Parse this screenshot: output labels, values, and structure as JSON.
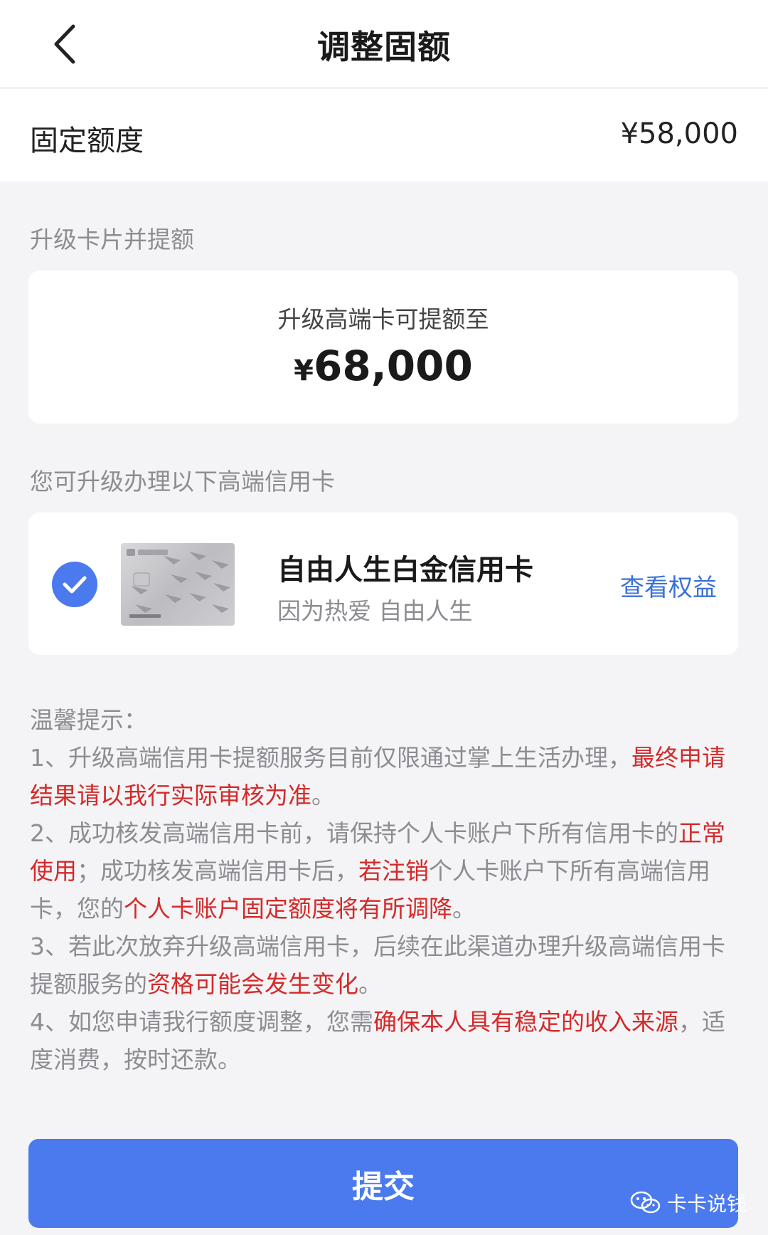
{
  "header": {
    "title": "调整固额"
  },
  "fixed_limit": {
    "label": "固定额度",
    "value": "¥58,000"
  },
  "upgrade_section": {
    "label": "升级卡片并提额",
    "subtitle": "升级高端卡可提额至",
    "currency": "¥",
    "amount": "68,000"
  },
  "card_section": {
    "label": "您可升级办理以下高端信用卡",
    "card": {
      "name": "自由人生白金信用卡",
      "slogan": "因为热爱 自由人生",
      "benefits_link": "查看权益",
      "selected": true
    }
  },
  "tips": {
    "title": "温馨提示：",
    "items": [
      [
        {
          "text": "1、升级高端信用卡提额服务目前仅限通过掌上生活办理，",
          "red": false
        },
        {
          "text": "最终申请结果请以我行实际审核为准",
          "red": true
        },
        {
          "text": "。",
          "red": false
        }
      ],
      [
        {
          "text": "2、成功核发高端信用卡前，请保持个人卡账户下所有信用卡的",
          "red": false
        },
        {
          "text": "正常使用",
          "red": true
        },
        {
          "text": "；成功核发高端信用卡后，",
          "red": false
        },
        {
          "text": "若注销",
          "red": true
        },
        {
          "text": "个人卡账户下所有高端信用卡，您的",
          "red": false
        },
        {
          "text": "个人卡账户固定额度将有所调降",
          "red": true
        },
        {
          "text": "。",
          "red": false
        }
      ],
      [
        {
          "text": "3、若此次放弃升级高端信用卡，后续在此渠道办理升级高端信用卡提额服务的",
          "red": false
        },
        {
          "text": "资格可能会发生变化",
          "red": true
        },
        {
          "text": "。",
          "red": false
        }
      ],
      [
        {
          "text": "4、如您申请我行额度调整，您需",
          "red": false
        },
        {
          "text": "确保本人具有稳定的收入来源",
          "red": true
        },
        {
          "text": "，适度消费，按时还款。",
          "red": false
        }
      ]
    ]
  },
  "submit_label": "提交",
  "watermark": "卡卡说钱",
  "colors": {
    "accent": "#4a7aed",
    "link": "#3a72d8",
    "warning": "#d42a2a"
  }
}
